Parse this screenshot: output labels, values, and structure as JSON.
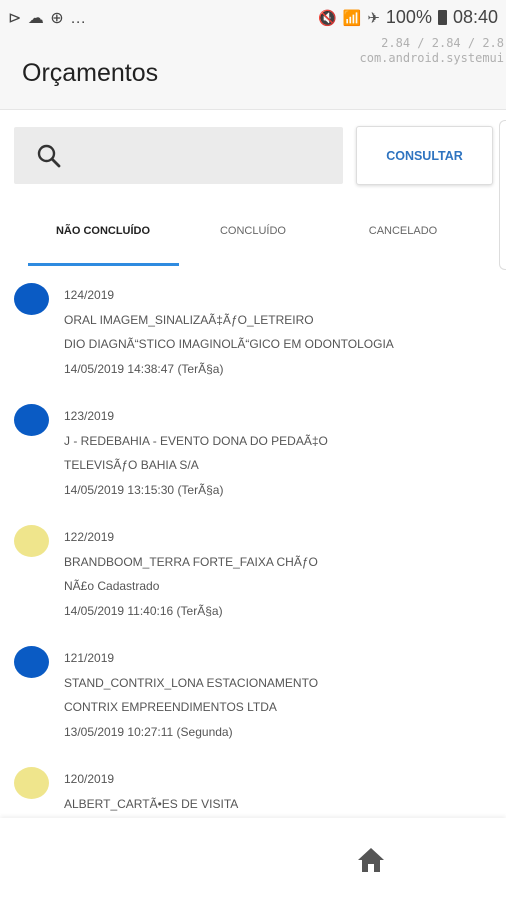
{
  "statusbar": {
    "left_icons": "⊳ ☁ ⊕ …",
    "battery": "100%",
    "time": "08:40"
  },
  "overlay": {
    "line1": "2.84 / 2.84 / 2.8",
    "line2": "com.android.systemui"
  },
  "appbar": {
    "title": "Orçamentos"
  },
  "search": {
    "placeholder": ""
  },
  "consult_button": {
    "label": "CONSULTAR"
  },
  "tabs": [
    {
      "label": "NÃO CONCLUÍDO"
    },
    {
      "label": "CONCLUÍDO"
    },
    {
      "label": "CANCELADO"
    }
  ],
  "colors": {
    "blue": "#0a5bc4",
    "yellow": "#efe58c",
    "accent": "#2f8be0"
  },
  "items": [
    {
      "code": "124/2019",
      "title": "ORAL IMAGEM_SINALIZAÃ‡ÃƒO_LETREIRO",
      "client": "DIO DIAGNÃ“STICO IMAGINOLÃ“GICO EM ODONTOLOGIA",
      "date": "14/05/2019 14:38:47 (TerÃ§a)",
      "status_color": "#0a5bc4"
    },
    {
      "code": "123/2019",
      "title": "J - REDEBAHIA - EVENTO DONA DO PEDAÃ‡O",
      "client": "TELEVISÃƒO BAHIA S/A",
      "date": "14/05/2019 13:15:30 (TerÃ§a)",
      "status_color": "#0a5bc4"
    },
    {
      "code": "122/2019",
      "title": "BRANDBOOM_TERRA FORTE_FAIXA CHÃƒO",
      "client": "NÃ£o Cadastrado",
      "date": "14/05/2019 11:40:16 (TerÃ§a)",
      "status_color": "#efe58c"
    },
    {
      "code": "121/2019",
      "title": "STAND_CONTRIX_LONA ESTACIONAMENTO",
      "client": "CONTRIX EMPREENDIMENTOS LTDA",
      "date": "13/05/2019 10:27:11 (Segunda)",
      "status_color": "#0a5bc4"
    },
    {
      "code": "120/2019",
      "title": "ALBERT_CARTÃ•ES DE VISITA",
      "client": "",
      "date": "",
      "status_color": "#efe58c"
    }
  ]
}
